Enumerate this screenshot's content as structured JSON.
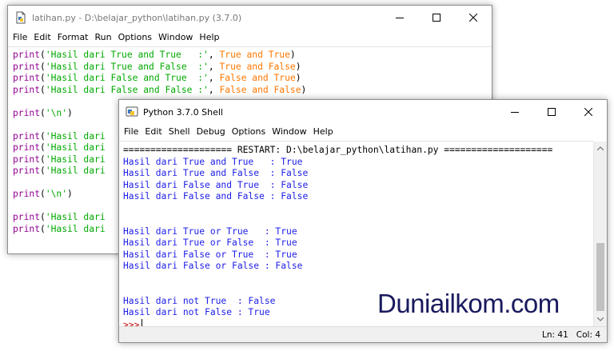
{
  "editor": {
    "title": "latihan.py - D:\\belajar_python\\latihan.py (3.7.0)",
    "menu": [
      "File",
      "Edit",
      "Format",
      "Run",
      "Options",
      "Window",
      "Help"
    ],
    "lines": [
      [
        [
          "kw",
          "print"
        ],
        [
          "op",
          "("
        ],
        [
          "st",
          "'Hasil dari True and True   :'"
        ],
        [
          "op",
          ", "
        ],
        [
          "tf",
          "True and True"
        ],
        [
          "op",
          ")"
        ]
      ],
      [
        [
          "kw",
          "print"
        ],
        [
          "op",
          "("
        ],
        [
          "st",
          "'Hasil dari True and False  :'"
        ],
        [
          "op",
          ", "
        ],
        [
          "tf",
          "True and False"
        ],
        [
          "op",
          ")"
        ]
      ],
      [
        [
          "kw",
          "print"
        ],
        [
          "op",
          "("
        ],
        [
          "st",
          "'Hasil dari False and True  :'"
        ],
        [
          "op",
          ", "
        ],
        [
          "tf",
          "False and True"
        ],
        [
          "op",
          ")"
        ]
      ],
      [
        [
          "kw",
          "print"
        ],
        [
          "op",
          "("
        ],
        [
          "st",
          "'Hasil dari False and False :'"
        ],
        [
          "op",
          ", "
        ],
        [
          "tf",
          "False and False"
        ],
        [
          "op",
          ")"
        ]
      ],
      [],
      [
        [
          "kw",
          "print"
        ],
        [
          "op",
          "("
        ],
        [
          "st",
          "'\\n'"
        ],
        [
          "op",
          ")"
        ]
      ],
      [],
      [
        [
          "kw",
          "print"
        ],
        [
          "op",
          "("
        ],
        [
          "st",
          "'Hasil dari"
        ]
      ],
      [
        [
          "kw",
          "print"
        ],
        [
          "op",
          "("
        ],
        [
          "st",
          "'Hasil dari"
        ]
      ],
      [
        [
          "kw",
          "print"
        ],
        [
          "op",
          "("
        ],
        [
          "st",
          "'Hasil dari"
        ]
      ],
      [
        [
          "kw",
          "print"
        ],
        [
          "op",
          "("
        ],
        [
          "st",
          "'Hasil dari"
        ]
      ],
      [],
      [
        [
          "kw",
          "print"
        ],
        [
          "op",
          "("
        ],
        [
          "st",
          "'\\n'"
        ],
        [
          "op",
          ")"
        ]
      ],
      [],
      [
        [
          "kw",
          "print"
        ],
        [
          "op",
          "("
        ],
        [
          "st",
          "'Hasil dari"
        ]
      ],
      [
        [
          "kw",
          "print"
        ],
        [
          "op",
          "("
        ],
        [
          "st",
          "'Hasil dari"
        ]
      ]
    ]
  },
  "shell": {
    "title": "Python 3.7.0 Shell",
    "menu": [
      "File",
      "Edit",
      "Shell",
      "Debug",
      "Options",
      "Window",
      "Help"
    ],
    "lines": [
      [
        "rst",
        "==================== RESTART: D:\\belajar_python\\latihan.py ===================="
      ],
      [
        "out",
        "Hasil dari True and True   : True"
      ],
      [
        "out",
        "Hasil dari True and False  : False"
      ],
      [
        "out",
        "Hasil dari False and True  : False"
      ],
      [
        "out",
        "Hasil dari False and False : False"
      ],
      [
        "out",
        ""
      ],
      [
        "out",
        ""
      ],
      [
        "out",
        "Hasil dari True or True   : True"
      ],
      [
        "out",
        "Hasil dari True or False  : True"
      ],
      [
        "out",
        "Hasil dari False or True  : True"
      ],
      [
        "out",
        "Hasil dari False or False : False"
      ],
      [
        "out",
        ""
      ],
      [
        "out",
        ""
      ],
      [
        "out",
        "Hasil dari not True  : False"
      ],
      [
        "out",
        "Hasil dari not False : True"
      ]
    ],
    "prompt": ">>>",
    "status": {
      "line": "Ln: 41",
      "col": "Col: 4"
    }
  },
  "watermark": "Duniailkom.com",
  "colors": {
    "keyword": "#900090",
    "string": "#00aa00",
    "builtin": "#ff7700",
    "output": "#2020e8",
    "prompt": "#c00000"
  }
}
